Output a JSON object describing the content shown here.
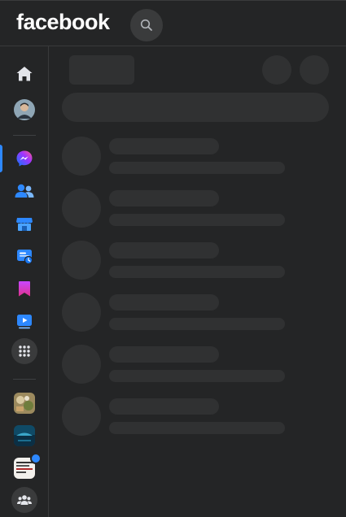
{
  "header": {
    "logo_text": "facebook"
  },
  "icons": {
    "search": "search-icon",
    "home": "home-icon",
    "profile": "profile-avatar",
    "messenger": "messenger-icon",
    "friends": "friends-icon",
    "marketplace": "marketplace-icon",
    "memories": "memories-icon",
    "saved": "saved-icon",
    "watch": "watch-icon",
    "menu": "menu-grid-icon",
    "groups": "groups-icon"
  },
  "colors": {
    "background": "#18191a",
    "surface": "#242526",
    "skeleton": "#303132",
    "accent": "#2d88ff",
    "text": "#ffffff"
  },
  "shortcuts": [
    {
      "name": "shortcut-1",
      "has_badge": false
    },
    {
      "name": "shortcut-2",
      "has_badge": false
    },
    {
      "name": "shortcut-3",
      "has_badge": true
    }
  ],
  "main": {
    "state": "loading",
    "skeleton_rows": 6
  }
}
